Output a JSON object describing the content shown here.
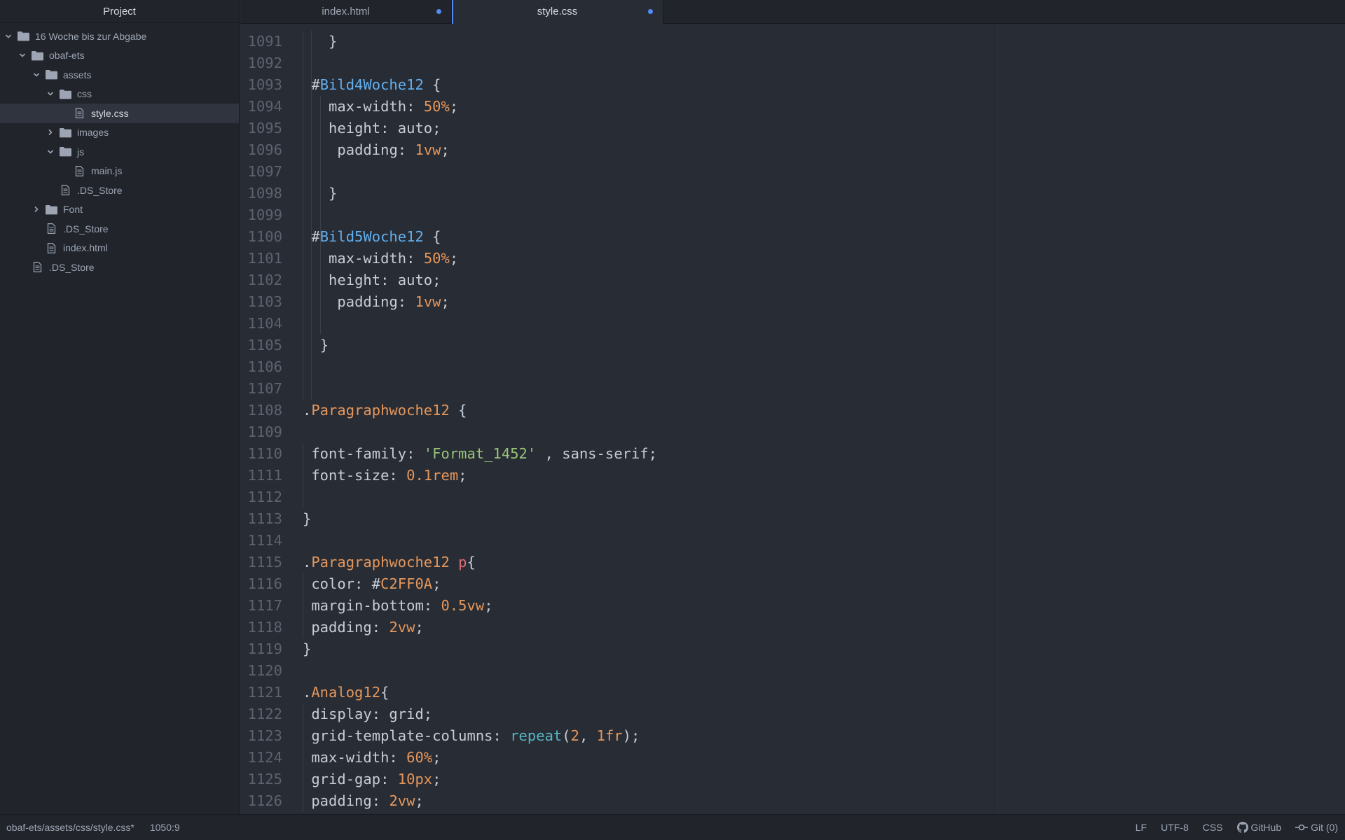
{
  "sidebar": {
    "title": "Project",
    "items": [
      {
        "label": "16 Woche bis zur Abgabe",
        "type": "folder",
        "depth": 0,
        "expanded": true
      },
      {
        "label": "obaf-ets",
        "type": "folder",
        "depth": 1,
        "expanded": true
      },
      {
        "label": "assets",
        "type": "folder",
        "depth": 2,
        "expanded": true
      },
      {
        "label": "css",
        "type": "folder",
        "depth": 3,
        "expanded": true
      },
      {
        "label": "style.css",
        "type": "file",
        "depth": 4,
        "selected": true
      },
      {
        "label": "images",
        "type": "folder",
        "depth": 3,
        "expanded": false
      },
      {
        "label": "js",
        "type": "folder",
        "depth": 3,
        "expanded": true
      },
      {
        "label": "main.js",
        "type": "file",
        "depth": 4
      },
      {
        "label": ".DS_Store",
        "type": "file",
        "depth": 3
      },
      {
        "label": "Font",
        "type": "folder",
        "depth": 2,
        "expanded": false
      },
      {
        "label": ".DS_Store",
        "type": "file",
        "depth": 2
      },
      {
        "label": "index.html",
        "type": "file",
        "depth": 2
      },
      {
        "label": ".DS_Store",
        "type": "file",
        "depth": 1
      }
    ]
  },
  "tabs": [
    {
      "label": "index.html",
      "active": false,
      "modified": true
    },
    {
      "label": "style.css",
      "active": true,
      "modified": true
    }
  ],
  "editor": {
    "lines": [
      {
        "n": "1091",
        "i": 3,
        "t": [
          [
            "punc",
            "}"
          ]
        ]
      },
      {
        "n": "1092",
        "i": 0,
        "t": []
      },
      {
        "n": "1093",
        "i": 1,
        "t": [
          [
            "punc",
            "#"
          ],
          [
            "id",
            "Bild4Woche12"
          ],
          [
            "punc",
            " {"
          ]
        ]
      },
      {
        "n": "1094",
        "i": 3,
        "t": [
          [
            "prop",
            "max-width: "
          ],
          [
            "num",
            "50%"
          ],
          [
            "punc",
            ";"
          ]
        ]
      },
      {
        "n": "1095",
        "i": 3,
        "t": [
          [
            "prop",
            "height: auto;"
          ]
        ]
      },
      {
        "n": "1096",
        "i": 4,
        "t": [
          [
            "prop",
            "padding: "
          ],
          [
            "num",
            "1vw"
          ],
          [
            "punc",
            ";"
          ]
        ]
      },
      {
        "n": "1097",
        "i": 0,
        "t": []
      },
      {
        "n": "1098",
        "i": 3,
        "t": [
          [
            "punc",
            "}"
          ]
        ]
      },
      {
        "n": "1099",
        "i": 0,
        "t": []
      },
      {
        "n": "1100",
        "i": 1,
        "t": [
          [
            "punc",
            "#"
          ],
          [
            "id",
            "Bild5Woche12"
          ],
          [
            "punc",
            " {"
          ]
        ]
      },
      {
        "n": "1101",
        "i": 3,
        "t": [
          [
            "prop",
            "max-width: "
          ],
          [
            "num",
            "50%"
          ],
          [
            "punc",
            ";"
          ]
        ]
      },
      {
        "n": "1102",
        "i": 3,
        "t": [
          [
            "prop",
            "height: auto;"
          ]
        ]
      },
      {
        "n": "1103",
        "i": 4,
        "t": [
          [
            "prop",
            "padding: "
          ],
          [
            "num",
            "1vw"
          ],
          [
            "punc",
            ";"
          ]
        ]
      },
      {
        "n": "1104",
        "i": 0,
        "t": []
      },
      {
        "n": "1105",
        "i": 2,
        "t": [
          [
            "punc",
            "}"
          ]
        ]
      },
      {
        "n": "1106",
        "i": 0,
        "t": []
      },
      {
        "n": "1107",
        "i": 0,
        "t": []
      },
      {
        "n": "1108",
        "i": 0,
        "t": [
          [
            "punc",
            "."
          ],
          [
            "class",
            "Paragraphwoche12"
          ],
          [
            "punc",
            " {"
          ]
        ]
      },
      {
        "n": "1109",
        "i": 0,
        "t": []
      },
      {
        "n": "1110",
        "i": 1,
        "t": [
          [
            "prop",
            "font-family: "
          ],
          [
            "str",
            "'Format_1452'"
          ],
          [
            "prop",
            " , sans-serif;"
          ]
        ]
      },
      {
        "n": "1111",
        "i": 1,
        "t": [
          [
            "prop",
            "font-size: "
          ],
          [
            "num",
            "0.1rem"
          ],
          [
            "punc",
            ";"
          ]
        ]
      },
      {
        "n": "1112",
        "i": 0,
        "t": []
      },
      {
        "n": "1113",
        "i": 0,
        "t": [
          [
            "punc",
            "}"
          ]
        ]
      },
      {
        "n": "1114",
        "i": 0,
        "t": []
      },
      {
        "n": "1115",
        "i": 0,
        "t": [
          [
            "punc",
            "."
          ],
          [
            "class",
            "Paragraphwoche12"
          ],
          [
            "punc",
            " "
          ],
          [
            "tag",
            "p"
          ],
          [
            "punc",
            "{"
          ]
        ]
      },
      {
        "n": "1116",
        "i": 1,
        "t": [
          [
            "prop",
            "color: #"
          ],
          [
            "hex",
            "C2FF0A"
          ],
          [
            "punc",
            ";"
          ]
        ]
      },
      {
        "n": "1117",
        "i": 1,
        "t": [
          [
            "prop",
            "margin-bottom: "
          ],
          [
            "num",
            "0.5vw"
          ],
          [
            "punc",
            ";"
          ]
        ]
      },
      {
        "n": "1118",
        "i": 1,
        "t": [
          [
            "prop",
            "padding: "
          ],
          [
            "num",
            "2vw"
          ],
          [
            "punc",
            ";"
          ]
        ]
      },
      {
        "n": "1119",
        "i": 0,
        "t": [
          [
            "punc",
            "}"
          ]
        ]
      },
      {
        "n": "1120",
        "i": 0,
        "t": []
      },
      {
        "n": "1121",
        "i": 0,
        "t": [
          [
            "punc",
            "."
          ],
          [
            "class",
            "Analog12"
          ],
          [
            "punc",
            "{"
          ]
        ]
      },
      {
        "n": "1122",
        "i": 1,
        "t": [
          [
            "prop",
            "display: grid;"
          ]
        ]
      },
      {
        "n": "1123",
        "i": 1,
        "t": [
          [
            "prop",
            "grid-template-columns: "
          ],
          [
            "fn",
            "repeat"
          ],
          [
            "punc",
            "("
          ],
          [
            "num",
            "2"
          ],
          [
            "punc",
            ", "
          ],
          [
            "num",
            "1fr"
          ],
          [
            "punc",
            ");"
          ]
        ]
      },
      {
        "n": "1124",
        "i": 1,
        "t": [
          [
            "prop",
            "max-width: "
          ],
          [
            "num",
            "60%"
          ],
          [
            "punc",
            ";"
          ]
        ]
      },
      {
        "n": "1125",
        "i": 1,
        "t": [
          [
            "prop",
            "grid-gap: "
          ],
          [
            "num",
            "10px"
          ],
          [
            "punc",
            ";"
          ]
        ]
      },
      {
        "n": "1126",
        "i": 1,
        "t": [
          [
            "prop",
            "padding: "
          ],
          [
            "num",
            "2vw"
          ],
          [
            "punc",
            ";"
          ]
        ]
      }
    ]
  },
  "statusbar": {
    "file_path": "obaf-ets/assets/css/style.css*",
    "cursor_position": "1050:9",
    "line_ending": "LF",
    "encoding": "UTF-8",
    "grammar": "CSS",
    "github_label": "GitHub",
    "git_label": "Git (0)"
  },
  "colors": {
    "accent": "#568af2",
    "background": "#282c34",
    "panel": "#21252b"
  }
}
